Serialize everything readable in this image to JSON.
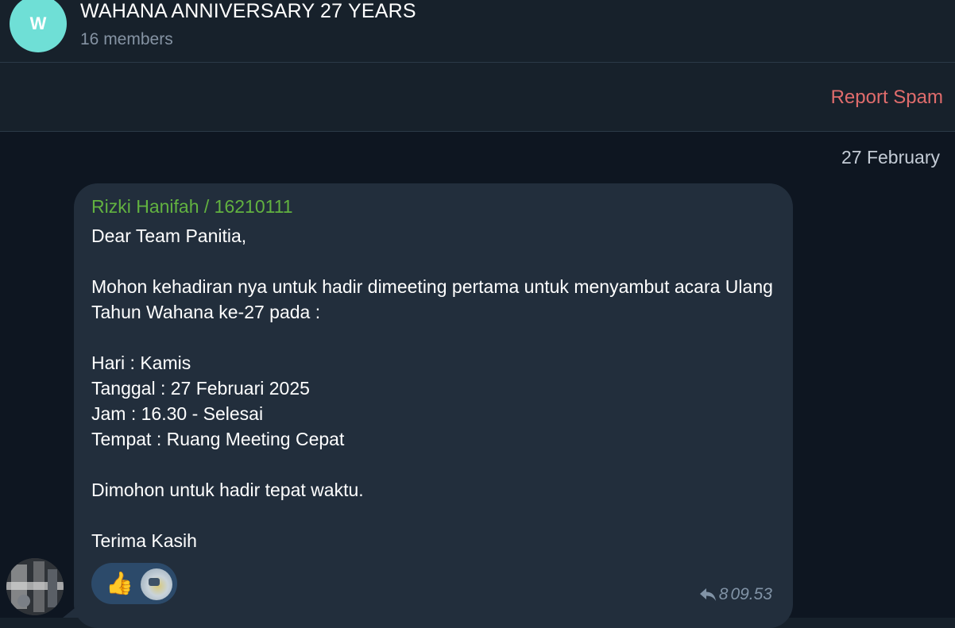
{
  "header": {
    "avatar_letter": "W",
    "title": "WAHANA ANNIVERSARY 27 YEARS",
    "subtitle": "16 members"
  },
  "spam_bar": {
    "report_label": "Report Spam"
  },
  "chat": {
    "date_label": "27 February",
    "message": {
      "sender": "Rizki Hanifah / 16210111",
      "text": "Dear Team Panitia,\n\nMohon kehadiran nya untuk hadir dimeeting pertama untuk menyambut acara Ulang Tahun Wahana ke-27 pada :\n\nHari : Kamis\nTanggal : 27 Februari 2025\nJam : 16.30 - Selesai\nTempat : Ruang Meeting Cepat\n\nDimohon untuk hadir tepat waktu.\n\nTerima Kasih",
      "reaction_emoji": "👍",
      "reply_count": "8",
      "time": "09.53"
    }
  },
  "colors": {
    "background": "#0e1621",
    "header_bg": "#17212b",
    "bubble_bg": "#222e3c",
    "sender_name": "#62b240",
    "report_spam": "#e06c6c",
    "avatar_bg": "#6fdfd6",
    "reaction_bg": "#2c4a6a"
  },
  "icons": {
    "reply": "reply-arrow-icon",
    "reaction": "thumbs-up-icon"
  }
}
